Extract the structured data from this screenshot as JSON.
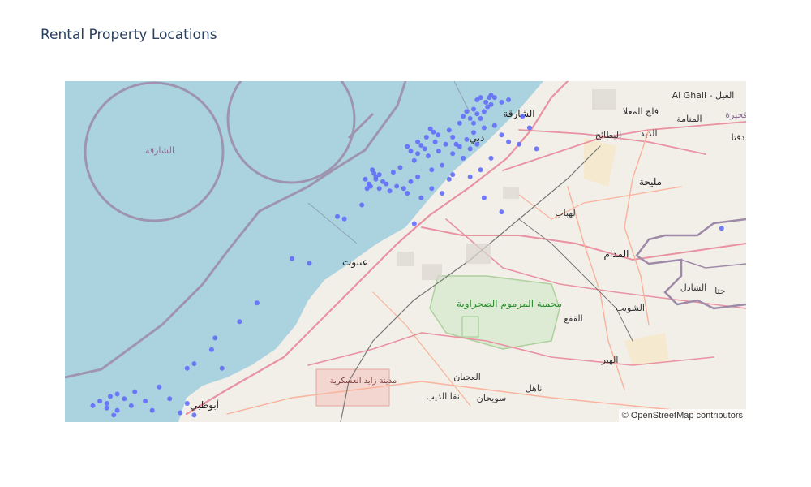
{
  "title": "Rental Property Locations",
  "attribution": "© OpenStreetMap contributors",
  "colors": {
    "water": "#aad3df",
    "land": "#f2efe9",
    "marker": "#636efa",
    "boundary": "#9e8aa8",
    "motorway": "#e892a2",
    "primary": "#f9b29c",
    "nature": "#c8e6b4"
  },
  "places": [
    {
      "id": "sharjah-sea",
      "label": "الشارقة"
    },
    {
      "id": "al-ghail",
      "label": "Al Ghail - الغيل"
    },
    {
      "id": "falaj",
      "label": "فلج المعلا"
    },
    {
      "id": "muntasir",
      "label": "المنامة"
    },
    {
      "id": "fujairah",
      "label": "فجيرة"
    },
    {
      "id": "dafta",
      "label": "دفتا"
    },
    {
      "id": "batayih",
      "label": "البطائح"
    },
    {
      "id": "dhaid",
      "label": "الذيد"
    },
    {
      "id": "sharjah",
      "label": "الشارقة"
    },
    {
      "id": "dubai",
      "label": "دبي"
    },
    {
      "id": "mleiha",
      "label": "مليحة"
    },
    {
      "id": "lahbab",
      "label": "لهباب"
    },
    {
      "id": "madam",
      "label": "المدام"
    },
    {
      "id": "jebel-ali",
      "label": "عنتوت"
    },
    {
      "id": "marmoum",
      "label": "محمية المرموم الصحراوية"
    },
    {
      "id": "shuwaib",
      "label": "الشويب"
    },
    {
      "id": "qaa",
      "label": "القفع"
    },
    {
      "id": "sadal",
      "label": "الشادل"
    },
    {
      "id": "hatta",
      "label": "حتا"
    },
    {
      "id": "hayer",
      "label": "الهير"
    },
    {
      "id": "zayed-city",
      "label": "مدينة زايد العسكرية"
    },
    {
      "id": "ajban",
      "label": "العجبان"
    },
    {
      "id": "naahil",
      "label": "ناهل"
    },
    {
      "id": "naqa",
      "label": "نقا الذيب"
    },
    {
      "id": "sweihan",
      "label": "سويحان"
    },
    {
      "id": "abudhabi",
      "label": "أبوظبي"
    }
  ],
  "points": [
    {
      "lng": 55.296,
      "lat": 25.276
    },
    {
      "lng": 55.305,
      "lat": 25.262
    },
    {
      "lng": 55.318,
      "lat": 25.25
    },
    {
      "lng": 55.285,
      "lat": 25.24
    },
    {
      "lng": 55.27,
      "lat": 25.205
    },
    {
      "lng": 55.28,
      "lat": 25.19
    },
    {
      "lng": 55.26,
      "lat": 25.17
    },
    {
      "lng": 55.25,
      "lat": 25.14
    },
    {
      "lng": 55.21,
      "lat": 25.11
    },
    {
      "lng": 55.19,
      "lat": 25.09
    },
    {
      "lng": 55.15,
      "lat": 25.08
    },
    {
      "lng": 55.14,
      "lat": 25.07
    },
    {
      "lng": 55.135,
      "lat": 25.085
    },
    {
      "lng": 55.13,
      "lat": 25.1
    },
    {
      "lng": 55.14,
      "lat": 25.06
    },
    {
      "lng": 55.16,
      "lat": 25.05
    },
    {
      "lng": 55.17,
      "lat": 25.04
    },
    {
      "lng": 55.2,
      "lat": 25.03
    },
    {
      "lng": 55.22,
      "lat": 25.02
    },
    {
      "lng": 55.24,
      "lat": 25.05
    },
    {
      "lng": 55.26,
      "lat": 25.07
    },
    {
      "lng": 55.3,
      "lat": 25.1
    },
    {
      "lng": 55.33,
      "lat": 25.12
    },
    {
      "lng": 55.36,
      "lat": 25.17
    },
    {
      "lng": 55.38,
      "lat": 25.2
    },
    {
      "lng": 55.4,
      "lat": 25.23
    },
    {
      "lng": 55.42,
      "lat": 25.26
    },
    {
      "lng": 55.45,
      "lat": 25.28
    },
    {
      "lng": 55.38,
      "lat": 25.3
    },
    {
      "lng": 55.39,
      "lat": 25.33
    },
    {
      "lng": 55.4,
      "lat": 25.35
    },
    {
      "lng": 55.42,
      "lat": 25.36
    },
    {
      "lng": 55.43,
      "lat": 25.34
    },
    {
      "lng": 55.44,
      "lat": 25.32
    },
    {
      "lng": 55.45,
      "lat": 25.35
    },
    {
      "lng": 55.46,
      "lat": 25.37
    },
    {
      "lng": 55.47,
      "lat": 25.38
    },
    {
      "lng": 55.41,
      "lat": 25.32
    },
    {
      "lng": 55.42,
      "lat": 25.3
    },
    {
      "lng": 55.5,
      "lat": 25.25
    },
    {
      "lng": 55.52,
      "lat": 25.22
    },
    {
      "lng": 55.55,
      "lat": 25.21
    },
    {
      "lng": 55.6,
      "lat": 25.19
    },
    {
      "lng": 55.47,
      "lat": 25.15
    },
    {
      "lng": 55.44,
      "lat": 25.1
    },
    {
      "lng": 55.41,
      "lat": 25.07
    },
    {
      "lng": 55.35,
      "lat": 25.06
    },
    {
      "lng": 55.3,
      "lat": 25.02
    },
    {
      "lng": 55.45,
      "lat": 24.98
    },
    {
      "lng": 55.5,
      "lat": 24.92
    },
    {
      "lng": 55.25,
      "lat": 24.87
    },
    {
      "lng": 55.1,
      "lat": 24.95
    },
    {
      "lng": 55.05,
      "lat": 24.89
    },
    {
      "lng": 55.03,
      "lat": 24.9
    },
    {
      "lng": 54.9,
      "lat": 24.72
    },
    {
      "lng": 54.95,
      "lat": 24.7
    },
    {
      "lng": 54.8,
      "lat": 24.53
    },
    {
      "lng": 54.75,
      "lat": 24.45
    },
    {
      "lng": 54.68,
      "lat": 24.38
    },
    {
      "lng": 54.67,
      "lat": 24.33
    },
    {
      "lng": 54.7,
      "lat": 24.25
    },
    {
      "lng": 54.62,
      "lat": 24.27
    },
    {
      "lng": 54.6,
      "lat": 24.25
    },
    {
      "lng": 54.52,
      "lat": 24.17
    },
    {
      "lng": 54.45,
      "lat": 24.15
    },
    {
      "lng": 54.4,
      "lat": 24.14
    },
    {
      "lng": 54.38,
      "lat": 24.13
    },
    {
      "lng": 54.37,
      "lat": 24.1
    },
    {
      "lng": 54.35,
      "lat": 24.11
    },
    {
      "lng": 54.4,
      "lat": 24.07
    },
    {
      "lng": 54.5,
      "lat": 24.07
    },
    {
      "lng": 54.55,
      "lat": 24.12
    },
    {
      "lng": 54.6,
      "lat": 24.1
    },
    {
      "lng": 54.58,
      "lat": 24.06
    },
    {
      "lng": 54.62,
      "lat": 24.05
    },
    {
      "lng": 54.33,
      "lat": 24.09
    },
    {
      "lng": 54.37,
      "lat": 24.08
    },
    {
      "lng": 54.42,
      "lat": 24.12
    },
    {
      "lng": 54.44,
      "lat": 24.09
    },
    {
      "lng": 54.48,
      "lat": 24.11
    },
    {
      "lng": 54.39,
      "lat": 24.05
    },
    {
      "lng": 56.13,
      "lat": 24.85
    },
    {
      "lng": 55.43,
      "lat": 25.4
    },
    {
      "lng": 55.44,
      "lat": 25.41
    },
    {
      "lng": 55.455,
      "lat": 25.39
    },
    {
      "lng": 55.465,
      "lat": 25.41
    },
    {
      "lng": 55.47,
      "lat": 25.42
    },
    {
      "lng": 55.48,
      "lat": 25.41
    },
    {
      "lng": 55.5,
      "lat": 25.39
    },
    {
      "lng": 55.52,
      "lat": 25.4
    },
    {
      "lng": 55.56,
      "lat": 25.33
    },
    {
      "lng": 55.58,
      "lat": 25.28
    },
    {
      "lng": 55.11,
      "lat": 25.06
    },
    {
      "lng": 55.12,
      "lat": 25.04
    },
    {
      "lng": 55.125,
      "lat": 25.03
    },
    {
      "lng": 55.115,
      "lat": 25.02
    },
    {
      "lng": 55.15,
      "lat": 25.02
    },
    {
      "lng": 55.18,
      "lat": 25.01
    },
    {
      "lng": 55.23,
      "lat": 25.0
    },
    {
      "lng": 55.27,
      "lat": 24.98
    },
    {
      "lng": 55.33,
      "lat": 25.0
    },
    {
      "lng": 55.36,
      "lat": 25.08
    },
    {
      "lng": 55.39,
      "lat": 25.15
    },
    {
      "lng": 55.48,
      "lat": 25.29
    },
    {
      "lng": 55.35,
      "lat": 25.27
    },
    {
      "lng": 55.36,
      "lat": 25.24
    },
    {
      "lng": 55.34,
      "lat": 25.21
    },
    {
      "lng": 55.32,
      "lat": 25.18
    },
    {
      "lng": 55.29,
      "lat": 25.16
    },
    {
      "lng": 55.24,
      "lat": 25.18
    },
    {
      "lng": 55.23,
      "lat": 25.2
    },
    {
      "lng": 55.26,
      "lat": 25.22
    },
    {
      "lng": 55.31,
      "lat": 25.22
    },
    {
      "lng": 55.37,
      "lat": 25.21
    },
    {
      "lng": 55.41,
      "lat": 25.19
    },
    {
      "lng": 55.43,
      "lat": 25.21
    }
  ]
}
